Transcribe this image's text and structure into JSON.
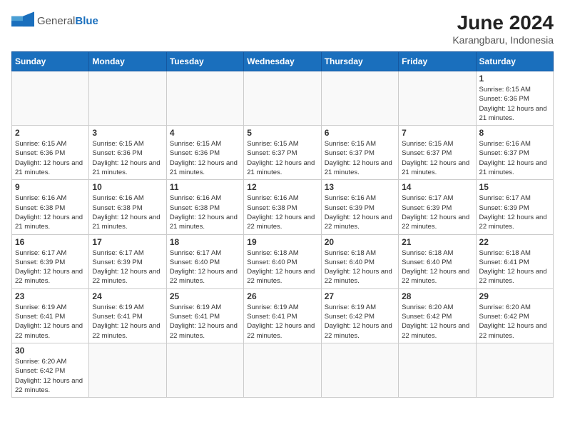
{
  "header": {
    "logo_general": "General",
    "logo_blue": "Blue",
    "month_year": "June 2024",
    "location": "Karangbaru, Indonesia"
  },
  "days_of_week": [
    "Sunday",
    "Monday",
    "Tuesday",
    "Wednesday",
    "Thursday",
    "Friday",
    "Saturday"
  ],
  "weeks": [
    [
      {
        "day": "",
        "info": ""
      },
      {
        "day": "",
        "info": ""
      },
      {
        "day": "",
        "info": ""
      },
      {
        "day": "",
        "info": ""
      },
      {
        "day": "",
        "info": ""
      },
      {
        "day": "",
        "info": ""
      },
      {
        "day": "1",
        "info": "Sunrise: 6:15 AM\nSunset: 6:36 PM\nDaylight: 12 hours and 21 minutes."
      }
    ],
    [
      {
        "day": "2",
        "info": "Sunrise: 6:15 AM\nSunset: 6:36 PM\nDaylight: 12 hours and 21 minutes."
      },
      {
        "day": "3",
        "info": "Sunrise: 6:15 AM\nSunset: 6:36 PM\nDaylight: 12 hours and 21 minutes."
      },
      {
        "day": "4",
        "info": "Sunrise: 6:15 AM\nSunset: 6:36 PM\nDaylight: 12 hours and 21 minutes."
      },
      {
        "day": "5",
        "info": "Sunrise: 6:15 AM\nSunset: 6:37 PM\nDaylight: 12 hours and 21 minutes."
      },
      {
        "day": "6",
        "info": "Sunrise: 6:15 AM\nSunset: 6:37 PM\nDaylight: 12 hours and 21 minutes."
      },
      {
        "day": "7",
        "info": "Sunrise: 6:15 AM\nSunset: 6:37 PM\nDaylight: 12 hours and 21 minutes."
      },
      {
        "day": "8",
        "info": "Sunrise: 6:16 AM\nSunset: 6:37 PM\nDaylight: 12 hours and 21 minutes."
      }
    ],
    [
      {
        "day": "9",
        "info": "Sunrise: 6:16 AM\nSunset: 6:38 PM\nDaylight: 12 hours and 21 minutes."
      },
      {
        "day": "10",
        "info": "Sunrise: 6:16 AM\nSunset: 6:38 PM\nDaylight: 12 hours and 21 minutes."
      },
      {
        "day": "11",
        "info": "Sunrise: 6:16 AM\nSunset: 6:38 PM\nDaylight: 12 hours and 21 minutes."
      },
      {
        "day": "12",
        "info": "Sunrise: 6:16 AM\nSunset: 6:38 PM\nDaylight: 12 hours and 22 minutes."
      },
      {
        "day": "13",
        "info": "Sunrise: 6:16 AM\nSunset: 6:39 PM\nDaylight: 12 hours and 22 minutes."
      },
      {
        "day": "14",
        "info": "Sunrise: 6:17 AM\nSunset: 6:39 PM\nDaylight: 12 hours and 22 minutes."
      },
      {
        "day": "15",
        "info": "Sunrise: 6:17 AM\nSunset: 6:39 PM\nDaylight: 12 hours and 22 minutes."
      }
    ],
    [
      {
        "day": "16",
        "info": "Sunrise: 6:17 AM\nSunset: 6:39 PM\nDaylight: 12 hours and 22 minutes."
      },
      {
        "day": "17",
        "info": "Sunrise: 6:17 AM\nSunset: 6:39 PM\nDaylight: 12 hours and 22 minutes."
      },
      {
        "day": "18",
        "info": "Sunrise: 6:17 AM\nSunset: 6:40 PM\nDaylight: 12 hours and 22 minutes."
      },
      {
        "day": "19",
        "info": "Sunrise: 6:18 AM\nSunset: 6:40 PM\nDaylight: 12 hours and 22 minutes."
      },
      {
        "day": "20",
        "info": "Sunrise: 6:18 AM\nSunset: 6:40 PM\nDaylight: 12 hours and 22 minutes."
      },
      {
        "day": "21",
        "info": "Sunrise: 6:18 AM\nSunset: 6:40 PM\nDaylight: 12 hours and 22 minutes."
      },
      {
        "day": "22",
        "info": "Sunrise: 6:18 AM\nSunset: 6:41 PM\nDaylight: 12 hours and 22 minutes."
      }
    ],
    [
      {
        "day": "23",
        "info": "Sunrise: 6:19 AM\nSunset: 6:41 PM\nDaylight: 12 hours and 22 minutes."
      },
      {
        "day": "24",
        "info": "Sunrise: 6:19 AM\nSunset: 6:41 PM\nDaylight: 12 hours and 22 minutes."
      },
      {
        "day": "25",
        "info": "Sunrise: 6:19 AM\nSunset: 6:41 PM\nDaylight: 12 hours and 22 minutes."
      },
      {
        "day": "26",
        "info": "Sunrise: 6:19 AM\nSunset: 6:41 PM\nDaylight: 12 hours and 22 minutes."
      },
      {
        "day": "27",
        "info": "Sunrise: 6:19 AM\nSunset: 6:42 PM\nDaylight: 12 hours and 22 minutes."
      },
      {
        "day": "28",
        "info": "Sunrise: 6:20 AM\nSunset: 6:42 PM\nDaylight: 12 hours and 22 minutes."
      },
      {
        "day": "29",
        "info": "Sunrise: 6:20 AM\nSunset: 6:42 PM\nDaylight: 12 hours and 22 minutes."
      }
    ],
    [
      {
        "day": "30",
        "info": "Sunrise: 6:20 AM\nSunset: 6:42 PM\nDaylight: 12 hours and 22 minutes."
      },
      {
        "day": "",
        "info": ""
      },
      {
        "day": "",
        "info": ""
      },
      {
        "day": "",
        "info": ""
      },
      {
        "day": "",
        "info": ""
      },
      {
        "day": "",
        "info": ""
      },
      {
        "day": "",
        "info": ""
      }
    ]
  ]
}
